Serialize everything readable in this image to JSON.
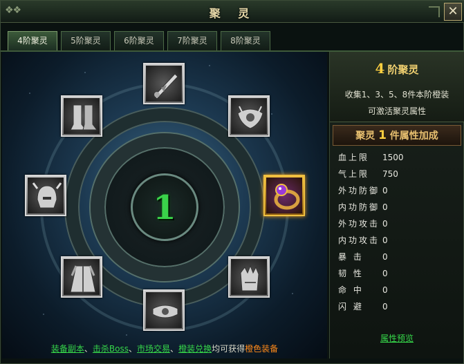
{
  "window": {
    "title": "聚 灵",
    "close_label": "✕"
  },
  "tabs": [
    {
      "label": "4阶聚灵",
      "active": true
    },
    {
      "label": "5阶聚灵",
      "active": false
    },
    {
      "label": "6阶聚灵",
      "active": false
    },
    {
      "label": "7阶聚灵",
      "active": false
    },
    {
      "label": "8阶聚灵",
      "active": false
    }
  ],
  "stage": {
    "center_count": "1",
    "slots": [
      {
        "name": "weapon-slot",
        "icon": "weapon-icon",
        "highlighted": false
      },
      {
        "name": "shoulder-slot",
        "icon": "shoulder-armor-icon",
        "highlighted": false
      },
      {
        "name": "ring-slot",
        "icon": "ring-icon",
        "highlighted": true
      },
      {
        "name": "gloves-slot",
        "icon": "gloves-icon",
        "highlighted": false
      },
      {
        "name": "belt-slot",
        "icon": "belt-icon",
        "highlighted": false
      },
      {
        "name": "armor-slot",
        "icon": "robe-icon",
        "highlighted": false
      },
      {
        "name": "helmet-slot",
        "icon": "helmet-icon",
        "highlighted": false
      },
      {
        "name": "boots-slot",
        "icon": "boots-icon",
        "highlighted": false
      }
    ]
  },
  "hint": {
    "link1": "装备副本",
    "link2": "击杀Boss",
    "link3": "市场交易",
    "link4": "橙装兑换",
    "sep": "、",
    "middle": "均可获得",
    "orange": "橙色装备"
  },
  "panel": {
    "title_num": "4",
    "title_text": "阶聚灵",
    "desc_line1": "收集1、3、5、8件本阶橙装",
    "desc_line2": "可激活聚灵属性",
    "bonus_prefix": "聚灵",
    "bonus_num": "1",
    "bonus_suffix": "件属性加成",
    "attributes": [
      {
        "name": "血上限",
        "value": "1500"
      },
      {
        "name": "气上限",
        "value": "750"
      },
      {
        "name": "外功防御",
        "value": "0"
      },
      {
        "name": "内功防御",
        "value": "0"
      },
      {
        "name": "外功攻击",
        "value": "0"
      },
      {
        "name": "内功攻击",
        "value": "0"
      },
      {
        "name": "暴 击",
        "value": "0"
      },
      {
        "name": "韧 性",
        "value": "0"
      },
      {
        "name": "命 中",
        "value": "0"
      },
      {
        "name": "闪 避",
        "value": "0"
      }
    ],
    "preview_label": "属性预览"
  },
  "colors": {
    "accent_green": "#36d84a",
    "gold": "#f0c040",
    "orange": "#ff8a1a"
  }
}
